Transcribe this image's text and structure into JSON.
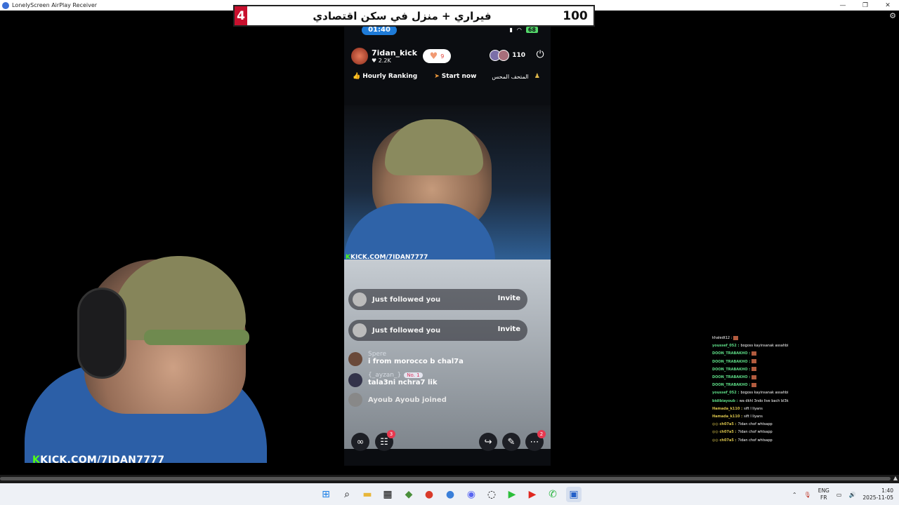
{
  "window": {
    "title": "LonelyScreen AirPlay Receiver",
    "controls": [
      "—",
      "❐",
      "✕"
    ]
  },
  "banner": {
    "left_number": "4",
    "text": "فيراري + منزل في سكن اقتصادي",
    "right_number": "100",
    "accent": "#c8102e"
  },
  "phone": {
    "status_time": "01:40",
    "battery": "68",
    "host": {
      "name": "7idan_kick",
      "likes": "2.2K",
      "pill_count": "9"
    },
    "viewer_count": "110",
    "hourly_ranking": "Hourly Ranking",
    "start_now": "Start now",
    "arabic_tag": "المتحف المحس",
    "video_link": "KICK.COM/7IDAN7777",
    "chat": {
      "follows": [
        {
          "text": "Just followed you",
          "action": "Invite"
        },
        {
          "text": "Just followed you",
          "action": "Invite"
        }
      ],
      "messages": [
        {
          "user": "Spere",
          "badge": "",
          "body": "i from morocco b chal7a"
        },
        {
          "user": "{_ayzan_}",
          "badge": "No. 1",
          "body": "tala3ni nchra7 lik"
        }
      ],
      "joined": "Ayoub Ayoub  joined"
    },
    "bottom": {
      "badge_left": "3",
      "badge_right": "2"
    }
  },
  "webcam": {
    "kick_overlay": "KICK.COM/7IDAN7777",
    "brand_color": "#53fc18"
  },
  "side_chat": [
    {
      "user": "khaledt12 :",
      "msg": "",
      "icon": true,
      "color": "white"
    },
    {
      "user": "youssef_052 :",
      "msg": "bogoss kayinsanak assahbi",
      "icon": false,
      "color": "green"
    },
    {
      "user": "DOON_TRABAKHO :",
      "msg": "",
      "icon": true,
      "color": "green"
    },
    {
      "user": "DOON_TRABAKHO :",
      "msg": "",
      "icon": true,
      "color": "green"
    },
    {
      "user": "DOON_TRABAKHO :",
      "msg": "",
      "icon": true,
      "color": "green"
    },
    {
      "user": "DOON_TRABAKHO :",
      "msg": "",
      "icon": true,
      "color": "green"
    },
    {
      "user": "DOON_TRABAKHO :",
      "msg": "",
      "icon": true,
      "color": "green"
    },
    {
      "user": "youssef_052 :",
      "msg": "bogoss kayinsanak assahbi",
      "icon": false,
      "color": "green"
    },
    {
      "user": "bidibiayoub :",
      "msg": "wa dkhl 3ndo live bach bl3k",
      "icon": false,
      "color": "green"
    },
    {
      "user": "Hamada_k110 :",
      "msg": "sift l liyans",
      "icon": false,
      "color": "gold"
    },
    {
      "user": "Hamada_k110 :",
      "msg": "sift l liyans",
      "icon": false,
      "color": "gold"
    },
    {
      "user": "◎◎ ch07a5 :",
      "msg": "7idan chof whtsapp",
      "icon": false,
      "color": "gold"
    },
    {
      "user": "◎◎ ch07a5 :",
      "msg": "7idan chof whtsapp",
      "icon": false,
      "color": "gold"
    },
    {
      "user": "◎◎ ch07a5 :",
      "msg": "7idan chof whtsapp",
      "icon": false,
      "color": "gold"
    }
  ],
  "taskbar": {
    "apps": [
      "start",
      "search",
      "file-explorer",
      "store",
      "layers",
      "chrome",
      "chrome-profile",
      "discord",
      "snipping",
      "kick",
      "youtube",
      "whatsapp",
      "lonelyscreen"
    ],
    "lang_top": "ENG",
    "lang_bottom": "FR",
    "time": "1:40",
    "date": "2025-11-05"
  }
}
